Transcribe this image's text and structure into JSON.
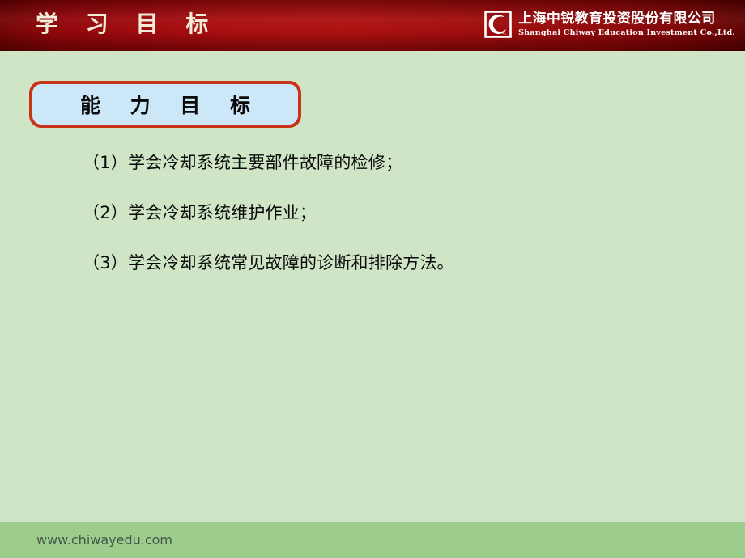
{
  "slide": {
    "background_color": "#cfe5c5"
  },
  "header": {
    "title": "学 习 目 标",
    "background_color": "#a80a0b",
    "title_color": "#f2ecd9",
    "logo": {
      "mark_icon": "chiway-c-logo-icon",
      "name_cn": "上海中锐教育投资股份有限公司",
      "name_en": "Shanghai Chiway Education Investment Co.,Ltd."
    }
  },
  "content": {
    "callout": {
      "label": "能 力 目 标",
      "fill_color": "#cce7f7",
      "border_color": "#c8341a"
    },
    "objectives": [
      "（1）学会冷却系统主要部件故障的检修；",
      "（2）学会冷却系统维护作业；",
      "（3）学会冷却系统常见故障的诊断和排除方法。"
    ]
  },
  "footer": {
    "url": "www.chiwayedu.com",
    "background_color": "#9ccd8d",
    "text_color": "#45544a"
  }
}
